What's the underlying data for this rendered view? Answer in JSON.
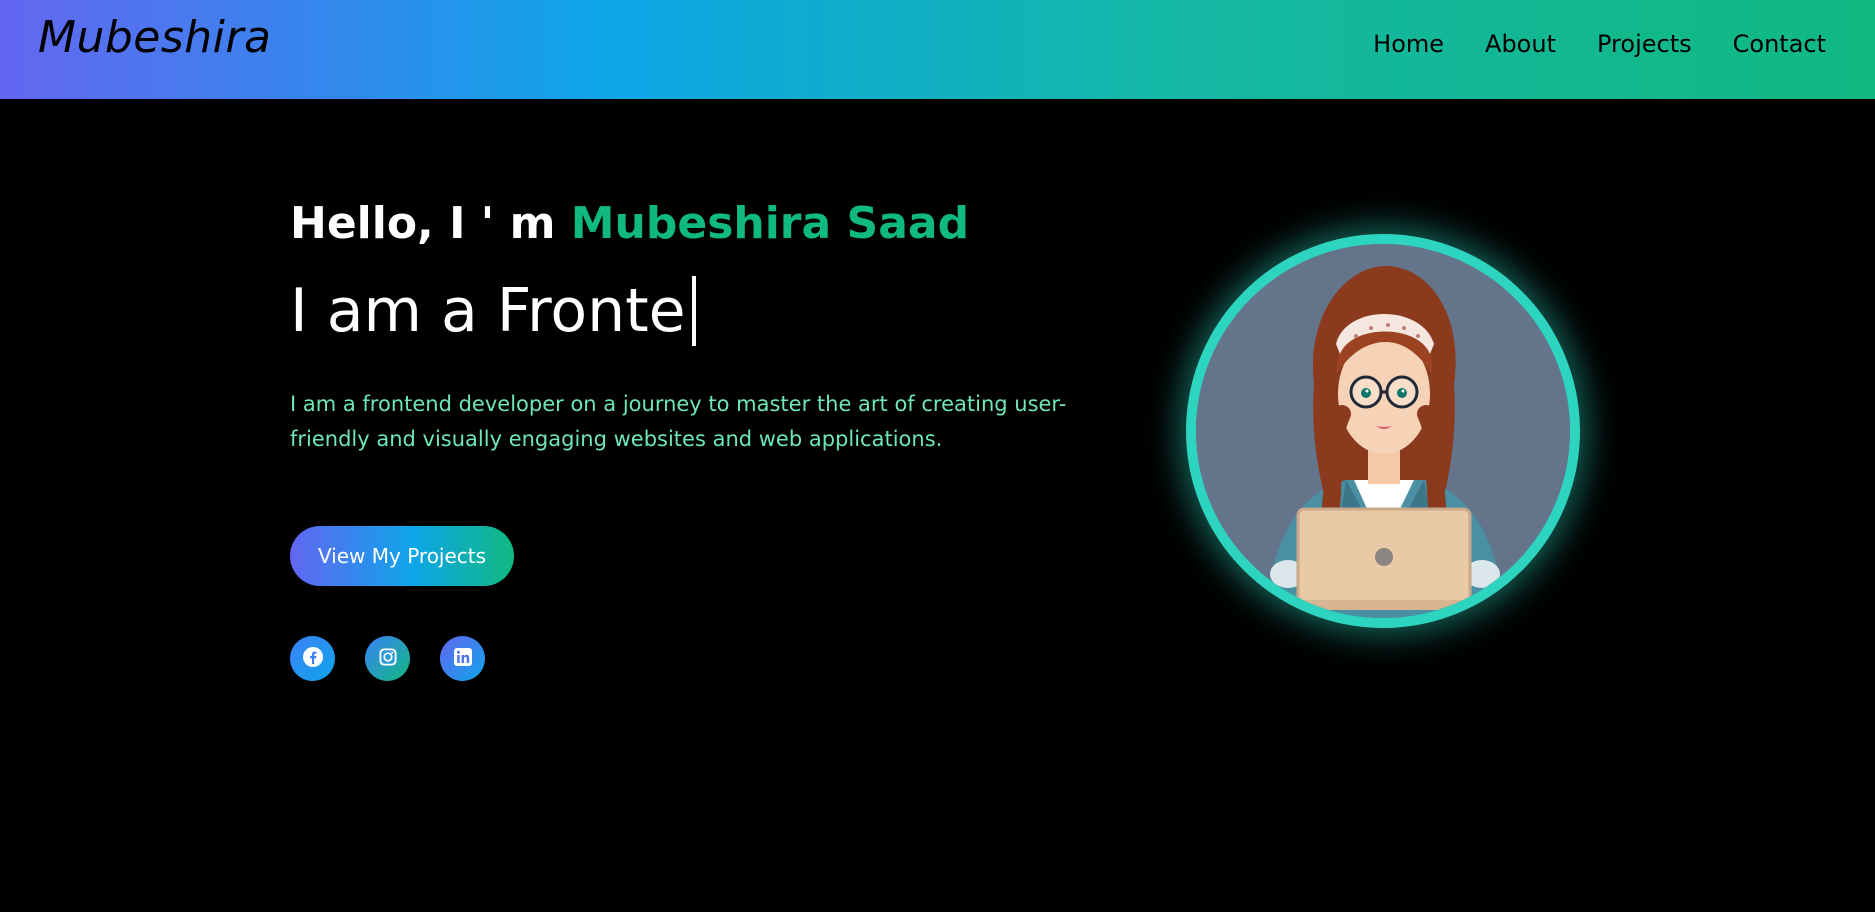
{
  "nav": {
    "logo": "Mubeshira",
    "links": [
      "Home",
      "About",
      "Projects",
      "Contact"
    ]
  },
  "hero": {
    "greeting_prefix": "Hello, I ' m",
    "greeting_name": "Mubeshira Saad",
    "typed_text": "I am a Fronte",
    "description": "I am a frontend developer on a journey to master the art of creating user-friendly and visually engaging websites and web applications.",
    "cta_label": "View My Projects"
  },
  "socials": [
    {
      "name": "facebook",
      "icon": "facebook-icon"
    },
    {
      "name": "instagram",
      "icon": "instagram-icon"
    },
    {
      "name": "linkedin",
      "icon": "linkedin-icon"
    }
  ],
  "colors": {
    "accent_green": "#10b981",
    "description_text": "#6ee7b7",
    "avatar_ring": "#2dd4bf",
    "gradient_start": "#6366f1",
    "gradient_mid": "#0ea5e9",
    "gradient_end": "#10b981"
  }
}
